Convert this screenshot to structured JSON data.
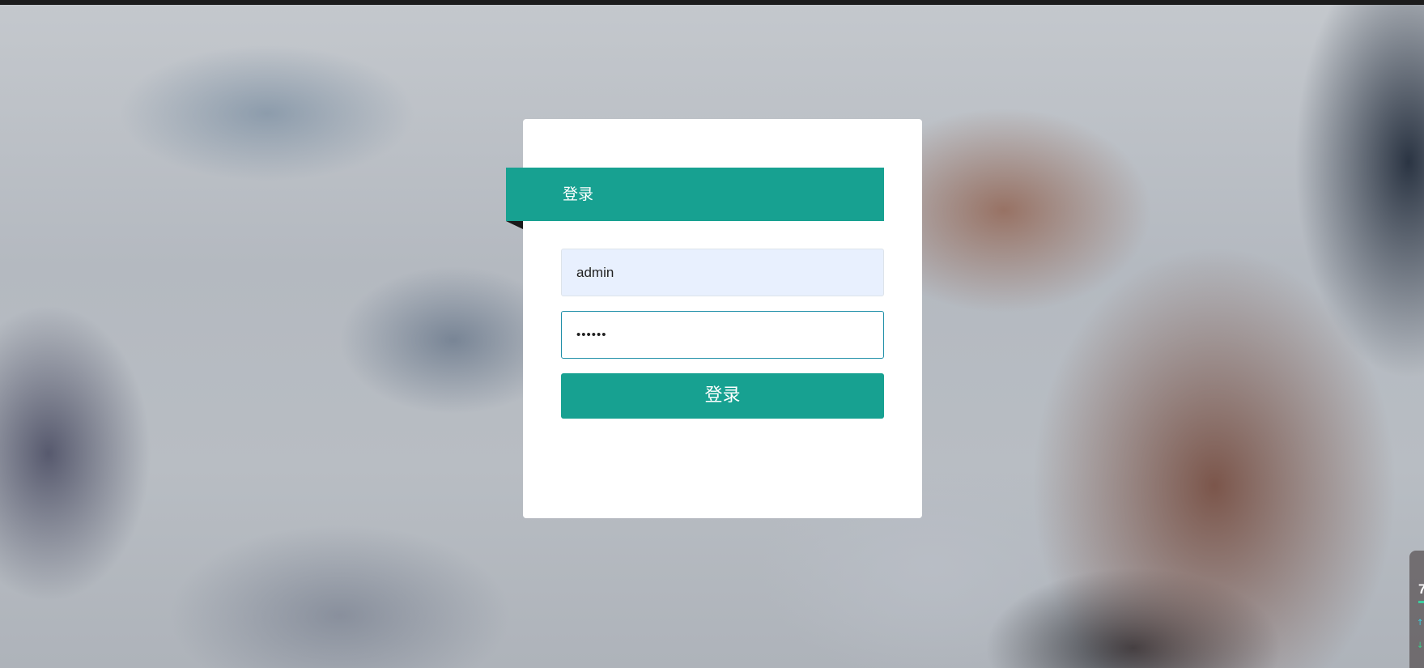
{
  "colors": {
    "accent": "#17a191",
    "card_background": "#ffffff",
    "username_field_background": "#e8f0fe",
    "password_focus_border": "#1f8fa8"
  },
  "login": {
    "header_title": "登录",
    "username_value": "admin",
    "password_value": "••••••",
    "submit_label": "登录"
  },
  "side_widget": {
    "number": "7",
    "up_icon": "arrow-up-icon",
    "down_icon": "arrow-down-icon"
  }
}
